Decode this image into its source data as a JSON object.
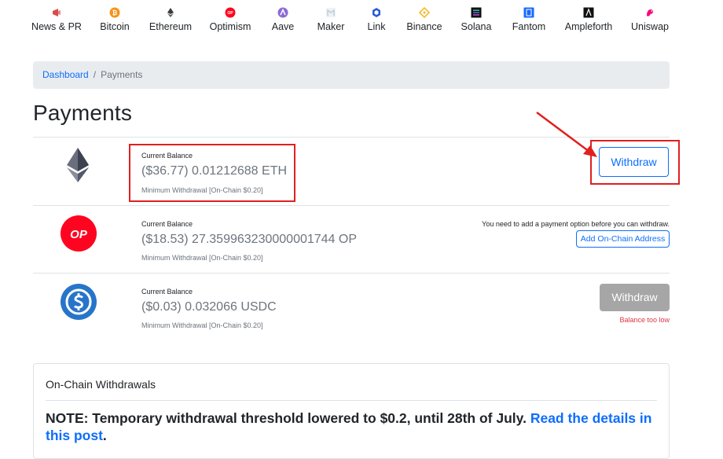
{
  "nav": {
    "items": [
      {
        "label": "News & PR",
        "icon": "megaphone-icon",
        "color": "#d94b4b"
      },
      {
        "label": "Bitcoin",
        "icon": "bitcoin-icon",
        "color": "#f7931a"
      },
      {
        "label": "Ethereum",
        "icon": "ethereum-icon",
        "color": "#3c3c3d"
      },
      {
        "label": "Optimism",
        "icon": "optimism-icon",
        "color": "#ff0420"
      },
      {
        "label": "Aave",
        "icon": "aave-icon",
        "color": "#8c6ad6"
      },
      {
        "label": "Maker",
        "icon": "maker-icon",
        "color": "#b8c7d6"
      },
      {
        "label": "Link",
        "icon": "chainlink-icon",
        "color": "#2a5ada"
      },
      {
        "label": "Binance",
        "icon": "binance-icon",
        "color": "#f3ba2f"
      },
      {
        "label": "Solana",
        "icon": "solana-icon",
        "color": "#111111"
      },
      {
        "label": "Fantom",
        "icon": "fantom-icon",
        "color": "#1969ff"
      },
      {
        "label": "Ampleforth",
        "icon": "ampleforth-icon",
        "color": "#111111"
      },
      {
        "label": "Uniswap",
        "icon": "uniswap-icon",
        "color": "#ff007a"
      }
    ]
  },
  "breadcrumb": {
    "home": "Dashboard",
    "separator": "/",
    "current": "Payments"
  },
  "page_title": "Payments",
  "payments": [
    {
      "token_icon": "ethereum-logo-icon",
      "balance_label": "Current Balance",
      "balance": "($36.77) 0.01212688 ETH",
      "minimum": "Minimum Withdrawal [On-Chain $0.20]",
      "button": "Withdraw"
    },
    {
      "token_icon": "optimism-logo-icon",
      "token_text": "OP",
      "balance_label": "Current Balance",
      "balance": "($18.53) 27.359963230000001744 OP",
      "minimum": "Minimum Withdrawal [On-Chain $0.20]",
      "message": "You need to add a payment option before you can withdraw.",
      "button": "Add On-Chain Address"
    },
    {
      "token_icon": "usdc-logo-icon",
      "balance_label": "Current Balance",
      "balance": "($0.03) 0.032066 USDC",
      "minimum": "Minimum Withdrawal [On-Chain $0.20]",
      "button": "Withdraw",
      "status": "Balance too low"
    }
  ],
  "onchain": {
    "title": "On-Chain Withdrawals",
    "note": "NOTE: Temporary withdrawal threshold lowered to $0.2, until 28th of July.",
    "link": "Read the details in this post",
    "trailing": "."
  },
  "colors": {
    "accent": "#0d6efd",
    "annotation": "#e0201f",
    "error": "#dc3545",
    "disabled": "#a6a6a6"
  }
}
